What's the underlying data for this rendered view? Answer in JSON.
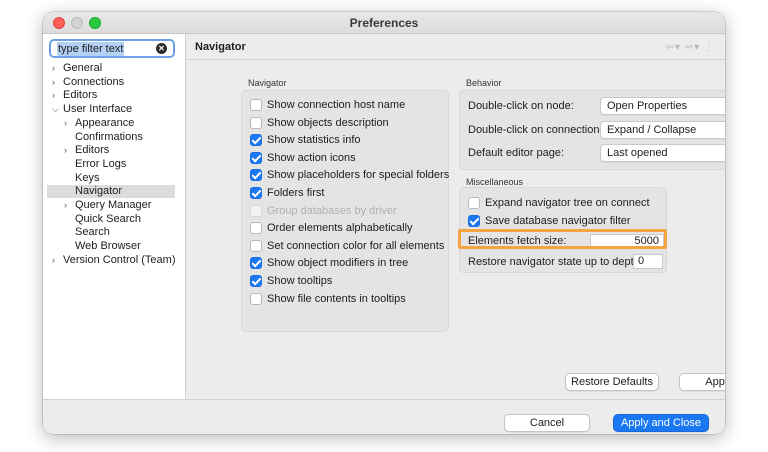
{
  "window": {
    "title": "Preferences"
  },
  "sidebar": {
    "filter_value": "type filter text",
    "tree": [
      {
        "label": "General",
        "level": 0,
        "expandable": true,
        "expanded": false
      },
      {
        "label": "Connections",
        "level": 0,
        "expandable": true,
        "expanded": false
      },
      {
        "label": "Editors",
        "level": 0,
        "expandable": true,
        "expanded": false
      },
      {
        "label": "User Interface",
        "level": 0,
        "expandable": true,
        "expanded": true
      },
      {
        "label": "Appearance",
        "level": 1,
        "expandable": true,
        "expanded": false
      },
      {
        "label": "Confirmations",
        "level": 1,
        "expandable": false
      },
      {
        "label": "Editors",
        "level": 1,
        "expandable": true,
        "expanded": false
      },
      {
        "label": "Error Logs",
        "level": 1,
        "expandable": false
      },
      {
        "label": "Keys",
        "level": 1,
        "expandable": false
      },
      {
        "label": "Navigator",
        "level": 1,
        "expandable": false,
        "selected": true
      },
      {
        "label": "Query Manager",
        "level": 1,
        "expandable": true,
        "expanded": false
      },
      {
        "label": "Quick Search",
        "level": 1,
        "expandable": false
      },
      {
        "label": "Search",
        "level": 1,
        "expandable": false
      },
      {
        "label": "Web Browser",
        "level": 1,
        "expandable": false
      },
      {
        "label": "Version Control (Team)",
        "level": 0,
        "expandable": true,
        "expanded": false
      }
    ]
  },
  "page": {
    "title": "Navigator"
  },
  "navigator_group": {
    "label": "Navigator",
    "options": [
      {
        "label": "Show connection host name",
        "checked": false,
        "disabled": false
      },
      {
        "label": "Show objects description",
        "checked": false,
        "disabled": false
      },
      {
        "label": "Show statistics info",
        "checked": true,
        "disabled": false
      },
      {
        "label": "Show action icons",
        "checked": true,
        "disabled": false
      },
      {
        "label": "Show placeholders for special folders",
        "checked": true,
        "disabled": false
      },
      {
        "label": "Folders first",
        "checked": true,
        "disabled": false
      },
      {
        "label": "Group databases by driver",
        "checked": false,
        "disabled": true
      },
      {
        "label": "Order elements alphabetically",
        "checked": false,
        "disabled": false
      },
      {
        "label": "Set connection color for all elements",
        "checked": false,
        "disabled": false
      },
      {
        "label": "Show object modifiers in tree",
        "checked": true,
        "disabled": false
      },
      {
        "label": "Show tooltips",
        "checked": true,
        "disabled": false
      },
      {
        "label": "Show file contents in tooltips",
        "checked": false,
        "disabled": false
      }
    ]
  },
  "behavior_group": {
    "label": "Behavior",
    "double_click_node_label": "Double-click on node:",
    "double_click_node_value": "Open Properties",
    "double_click_connection_label": "Double-click on connection:",
    "double_click_connection_value": "Expand / Collapse",
    "default_editor_label": "Default editor page:",
    "default_editor_value": "Last opened"
  },
  "misc_group": {
    "label": "Miscellaneous",
    "expand_tree_label": "Expand navigator tree on connect",
    "expand_tree_checked": false,
    "save_filter_label": "Save database navigator filter",
    "save_filter_checked": true,
    "fetch_size_label": "Elements fetch size:",
    "fetch_size_value": "5000",
    "restore_depth_label": "Restore navigator state up to depth:",
    "restore_depth_value": "0"
  },
  "buttons": {
    "restore_defaults": "Restore Defaults",
    "apply": "Apply",
    "cancel": "Cancel",
    "apply_and_close": "Apply and Close"
  },
  "colors": {
    "accent": "#1a78f2",
    "highlight": "#f5a443",
    "close": "#fe5f57",
    "zoom": "#28c840"
  }
}
